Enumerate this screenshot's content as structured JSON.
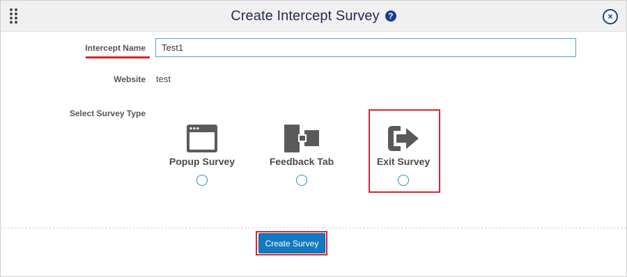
{
  "dialog": {
    "title": "Create Intercept Survey",
    "help_icon": "question-circle-icon",
    "close_icon": "close-circle-icon",
    "drag_icon": "drag-dots-icon"
  },
  "form": {
    "intercept_name_label": "Intercept Name",
    "intercept_name_value": "Test1",
    "website_label": "Website",
    "website_value": "test",
    "survey_type_label": "Select Survey Type"
  },
  "survey_types": [
    {
      "label": "Popup Survey",
      "icon": "browser-window-icon",
      "selected": false
    },
    {
      "label": "Feedback Tab",
      "icon": "feedback-tab-icon",
      "selected": false
    },
    {
      "label": "Exit Survey",
      "icon": "exit-arrow-icon",
      "selected": false
    }
  ],
  "actions": {
    "create_label": "Create Survey"
  },
  "colors": {
    "accent": "#1479c0",
    "highlight": "#d9232e",
    "title": "#1f2a4d",
    "icon": "#5a5a5a"
  }
}
